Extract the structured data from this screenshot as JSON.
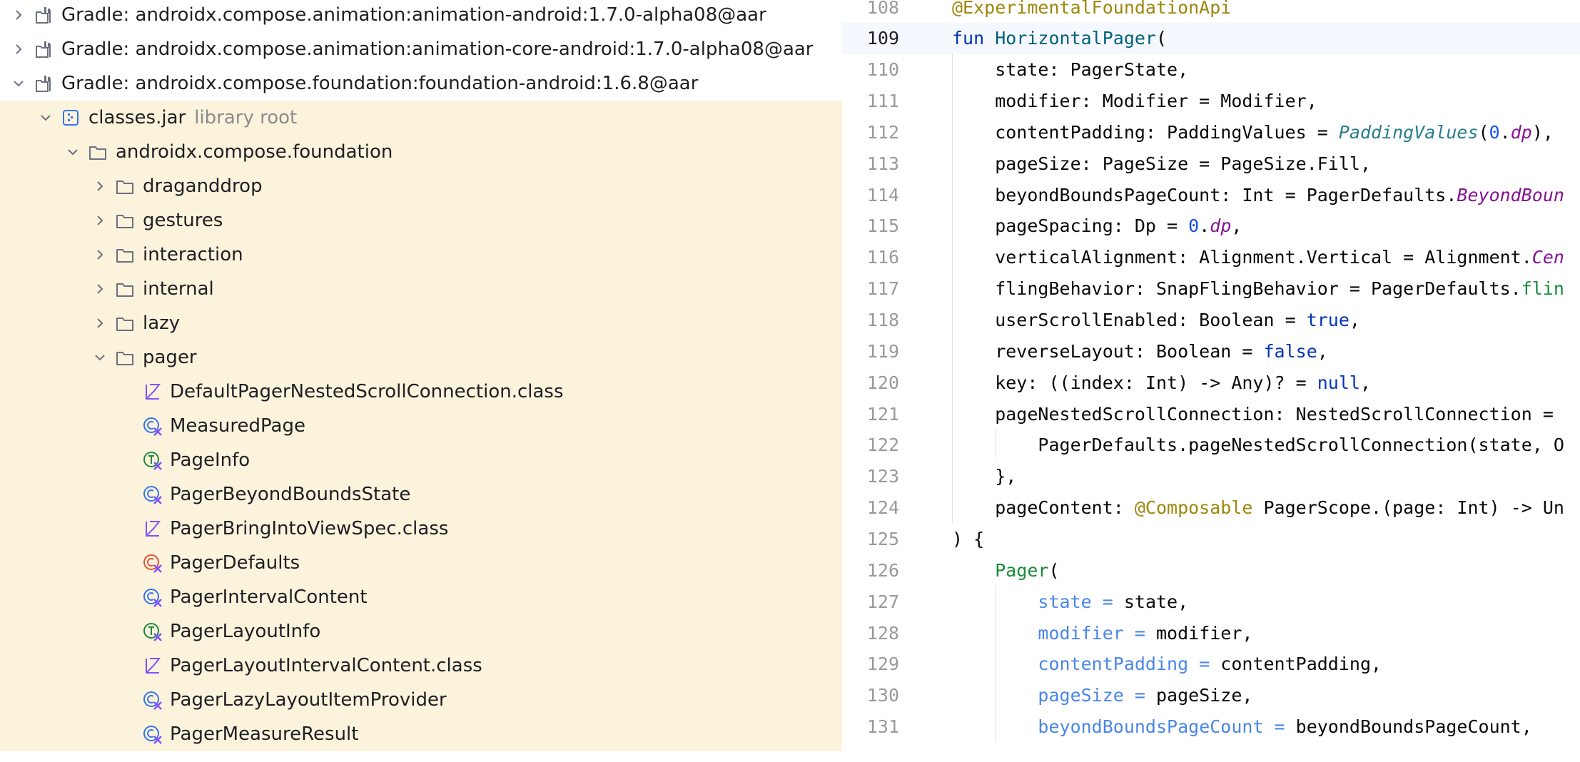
{
  "colors": {
    "library_bg": "#fcf3dd",
    "current_line_bg": "#f5f8fe",
    "annotation": "#9e880d",
    "keyword": "#0033b3",
    "function_decl": "#00627a",
    "function_call": "#188b3a",
    "number": "#1750eb",
    "property": "#871094",
    "named_arg": "#4a86e8"
  },
  "project": {
    "items": [
      {
        "label": "Gradle: androidx.compose.animation:animation-android:1.7.0-alpha08@aar",
        "icon": "library-icon",
        "expand": "collapsed"
      },
      {
        "label": "Gradle: androidx.compose.animation:animation-core-android:1.7.0-alpha08@aar",
        "icon": "library-icon",
        "expand": "collapsed"
      },
      {
        "label": "Gradle: androidx.compose.foundation:foundation-android:1.6.8@aar",
        "icon": "library-icon",
        "expand": "expanded"
      },
      {
        "label": "classes.jar",
        "hint": "library root",
        "icon": "jar-icon",
        "expand": "expanded"
      },
      {
        "label": "androidx.compose.foundation",
        "icon": "package-icon",
        "expand": "expanded"
      },
      {
        "label": "draganddrop",
        "icon": "package-icon",
        "expand": "collapsed"
      },
      {
        "label": "gestures",
        "icon": "package-icon",
        "expand": "collapsed"
      },
      {
        "label": "interaction",
        "icon": "package-icon",
        "expand": "collapsed"
      },
      {
        "label": "internal",
        "icon": "package-icon",
        "expand": "collapsed"
      },
      {
        "label": "lazy",
        "icon": "package-icon",
        "expand": "collapsed"
      },
      {
        "label": "pager",
        "icon": "package-icon",
        "expand": "expanded"
      },
      {
        "label": "DefaultPagerNestedScrollConnection.class",
        "icon": "kotlin-file-icon",
        "expand": "none"
      },
      {
        "label": "MeasuredPage",
        "icon": "kotlin-class-icon",
        "expand": "none"
      },
      {
        "label": "PageInfo",
        "icon": "kotlin-interface-icon",
        "expand": "none"
      },
      {
        "label": "PagerBeyondBoundsState",
        "icon": "kotlin-class-icon",
        "expand": "none"
      },
      {
        "label": "PagerBringIntoViewSpec.class",
        "icon": "kotlin-file-icon",
        "expand": "none"
      },
      {
        "label": "PagerDefaults",
        "icon": "kotlin-object-icon",
        "expand": "none"
      },
      {
        "label": "PagerIntervalContent",
        "icon": "kotlin-class-icon",
        "expand": "none"
      },
      {
        "label": "PagerLayoutInfo",
        "icon": "kotlin-interface-icon",
        "expand": "none"
      },
      {
        "label": "PagerLayoutIntervalContent.class",
        "icon": "kotlin-file-icon",
        "expand": "none"
      },
      {
        "label": "PagerLazyLayoutItemProvider",
        "icon": "kotlin-class-icon",
        "expand": "none"
      },
      {
        "label": "PagerMeasureResult",
        "icon": "kotlin-class-icon",
        "expand": "none"
      }
    ]
  },
  "editor": {
    "current_line": "109",
    "lines": [
      {
        "num": "108",
        "tokens": [
          {
            "t": "@ExperimentalFoundationApi",
            "c": "t-ann"
          }
        ]
      },
      {
        "num": "109",
        "tokens": [
          {
            "t": "fun ",
            "c": "t-kw"
          },
          {
            "t": "HorizontalPager",
            "c": "t-fn"
          },
          {
            "t": "(",
            "c": "t-plain"
          }
        ]
      },
      {
        "num": "110",
        "tokens": [
          {
            "t": "    state: PagerState,",
            "c": "t-plain"
          }
        ]
      },
      {
        "num": "111",
        "tokens": [
          {
            "t": "    modifier: Modifier = Modifier,",
            "c": "t-plain"
          }
        ]
      },
      {
        "num": "112",
        "tokens": [
          {
            "t": "    contentPadding: PaddingValues = ",
            "c": "t-plain"
          },
          {
            "t": "PaddingValues",
            "c": "t-it"
          },
          {
            "t": "(",
            "c": "t-plain"
          },
          {
            "t": "0",
            "c": "t-num"
          },
          {
            "t": ".",
            "c": "t-plain"
          },
          {
            "t": "dp",
            "c": "t-prop"
          },
          {
            "t": "),",
            "c": "t-plain"
          }
        ]
      },
      {
        "num": "113",
        "tokens": [
          {
            "t": "    pageSize: PageSize = PageSize.Fill,",
            "c": "t-plain"
          }
        ]
      },
      {
        "num": "114",
        "tokens": [
          {
            "t": "    beyondBoundsPageCount: Int = PagerDefaults.",
            "c": "t-plain"
          },
          {
            "t": "BeyondBoun",
            "c": "t-prop"
          }
        ]
      },
      {
        "num": "115",
        "tokens": [
          {
            "t": "    pageSpacing: Dp = ",
            "c": "t-plain"
          },
          {
            "t": "0",
            "c": "t-num"
          },
          {
            "t": ".",
            "c": "t-plain"
          },
          {
            "t": "dp",
            "c": "t-prop"
          },
          {
            "t": ",",
            "c": "t-plain"
          }
        ]
      },
      {
        "num": "116",
        "tokens": [
          {
            "t": "    verticalAlignment: Alignment.Vertical = Alignment.",
            "c": "t-plain"
          },
          {
            "t": "Cen",
            "c": "t-prop"
          }
        ]
      },
      {
        "num": "117",
        "tokens": [
          {
            "t": "    flingBehavior: SnapFlingBehavior = PagerDefaults.",
            "c": "t-plain"
          },
          {
            "t": "flin",
            "c": "t-call"
          }
        ]
      },
      {
        "num": "118",
        "tokens": [
          {
            "t": "    userScrollEnabled: Boolean = ",
            "c": "t-plain"
          },
          {
            "t": "true",
            "c": "t-kw"
          },
          {
            "t": ",",
            "c": "t-plain"
          }
        ]
      },
      {
        "num": "119",
        "tokens": [
          {
            "t": "    reverseLayout: Boolean = ",
            "c": "t-plain"
          },
          {
            "t": "false",
            "c": "t-kw"
          },
          {
            "t": ",",
            "c": "t-plain"
          }
        ]
      },
      {
        "num": "120",
        "tokens": [
          {
            "t": "    key: ((index: Int) -> Any)? = ",
            "c": "t-plain"
          },
          {
            "t": "null",
            "c": "t-kw"
          },
          {
            "t": ",",
            "c": "t-plain"
          }
        ]
      },
      {
        "num": "121",
        "tokens": [
          {
            "t": "    pageNestedScrollConnection: NestedScrollConnection = ",
            "c": "t-plain"
          }
        ]
      },
      {
        "num": "122",
        "tokens": [
          {
            "t": "        PagerDefaults.pageNestedScrollConnection(state, O",
            "c": "t-plain"
          }
        ]
      },
      {
        "num": "123",
        "tokens": [
          {
            "t": "    },",
            "c": "t-plain"
          }
        ]
      },
      {
        "num": "124",
        "tokens": [
          {
            "t": "    pageContent: ",
            "c": "t-plain"
          },
          {
            "t": "@Composable",
            "c": "t-ann"
          },
          {
            "t": " PagerScope.(page: Int) -> Un",
            "c": "t-plain"
          }
        ]
      },
      {
        "num": "125",
        "tokens": [
          {
            "t": ") {",
            "c": "t-plain"
          }
        ]
      },
      {
        "num": "126",
        "tokens": [
          {
            "t": "    ",
            "c": "t-plain"
          },
          {
            "t": "Pager",
            "c": "t-call"
          },
          {
            "t": "(",
            "c": "t-plain"
          }
        ]
      },
      {
        "num": "127",
        "tokens": [
          {
            "t": "        ",
            "c": "t-plain"
          },
          {
            "t": "state = ",
            "c": "t-arg"
          },
          {
            "t": "state,",
            "c": "t-plain"
          }
        ]
      },
      {
        "num": "128",
        "tokens": [
          {
            "t": "        ",
            "c": "t-plain"
          },
          {
            "t": "modifier = ",
            "c": "t-arg"
          },
          {
            "t": "modifier,",
            "c": "t-plain"
          }
        ]
      },
      {
        "num": "129",
        "tokens": [
          {
            "t": "        ",
            "c": "t-plain"
          },
          {
            "t": "contentPadding = ",
            "c": "t-arg"
          },
          {
            "t": "contentPadding,",
            "c": "t-plain"
          }
        ]
      },
      {
        "num": "130",
        "tokens": [
          {
            "t": "        ",
            "c": "t-plain"
          },
          {
            "t": "pageSize = ",
            "c": "t-arg"
          },
          {
            "t": "pageSize,",
            "c": "t-plain"
          }
        ]
      },
      {
        "num": "131",
        "tokens": [
          {
            "t": "        ",
            "c": "t-plain"
          },
          {
            "t": "beyondBoundsPageCount = ",
            "c": "t-arg"
          },
          {
            "t": "beyondBoundsPageCount,",
            "c": "t-plain"
          }
        ]
      }
    ]
  }
}
